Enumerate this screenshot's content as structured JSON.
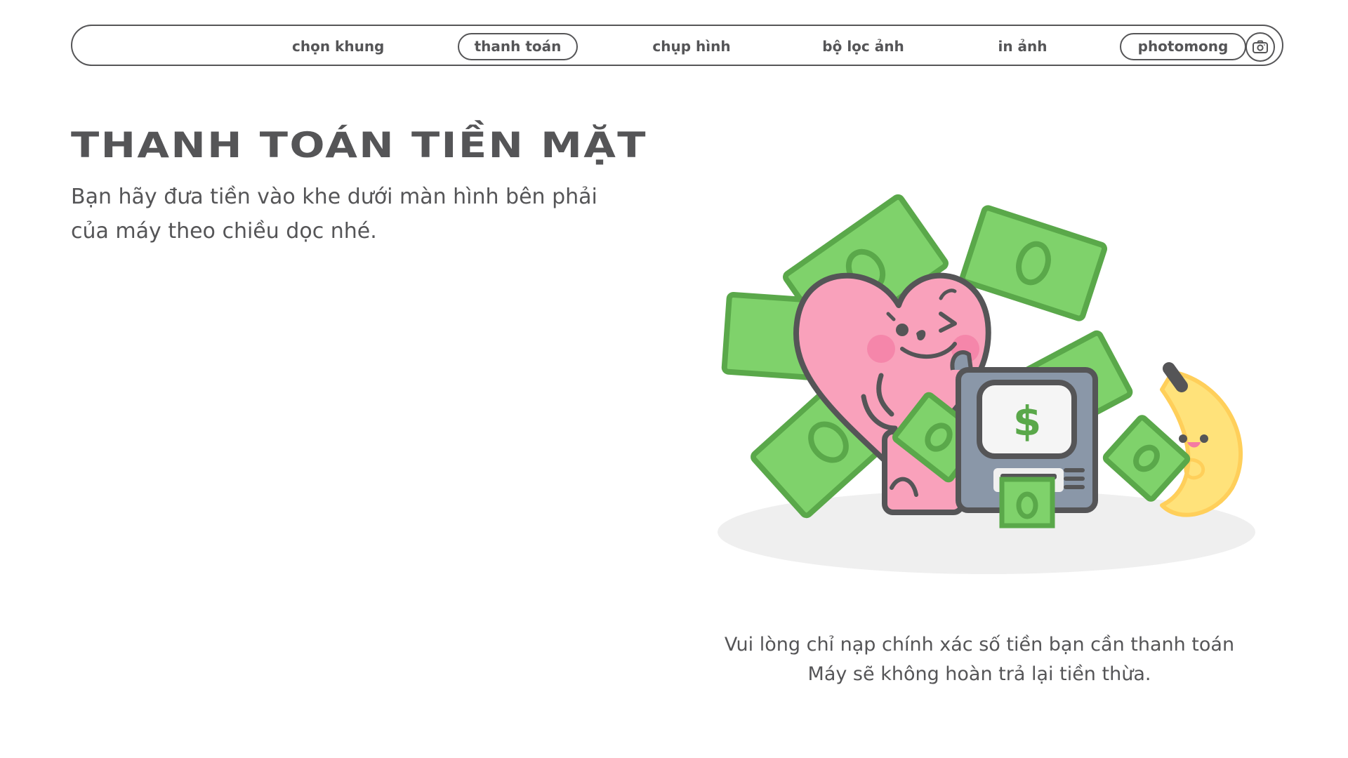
{
  "nav": {
    "items": [
      {
        "label": "chọn khung",
        "active": false
      },
      {
        "label": "thanh toán",
        "active": true
      },
      {
        "label": "chụp hình",
        "active": false
      },
      {
        "label": "bộ lọc ảnh",
        "active": false
      },
      {
        "label": "in ảnh",
        "active": false
      },
      {
        "label": "photomong",
        "active": false
      }
    ],
    "camera_icon": "camera-icon"
  },
  "main": {
    "title": "THANH TOÁN TIỀN MẶT",
    "subtitle": "Bạn hãy đưa tiền vào khe dưới màn hình bên phải của máy theo chiều dọc nhé.",
    "illustration": {
      "atm_screen_symbol": "$"
    }
  },
  "notice": {
    "line1": "Vui lòng chỉ nạp chính xác số tiền bạn cần thanh toán",
    "line2": "Máy sẽ không hoàn trả lại tiền thừa."
  },
  "colors": {
    "text": "#555557",
    "money_green": "#6cbf56",
    "heart_pink": "#f9a1bb",
    "banana_yellow": "#ffe27a",
    "atm_gray": "#8a97a8"
  }
}
